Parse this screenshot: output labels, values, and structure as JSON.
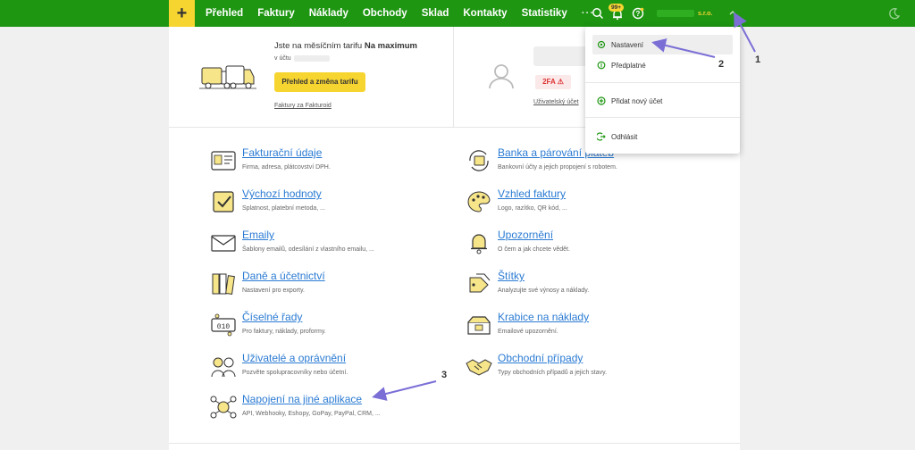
{
  "topbar": {
    "plus_label": "+",
    "nav": [
      "Přehled",
      "Faktury",
      "Náklady",
      "Obchody",
      "Sklad",
      "Kontakty",
      "Statistiky",
      "···"
    ],
    "notif_badge": "99+",
    "account_suffix": "s.r.o."
  },
  "plan": {
    "text_prefix": "Jste na měsíčním tarifu ",
    "text_bold": "Na maximum",
    "account_label": "v účtu",
    "button": "Přehled a změna tarifu",
    "link": "Faktury za Fakturoid"
  },
  "user": {
    "twofa": "2FA",
    "link": "Uživatelský účet"
  },
  "settings_left": [
    {
      "title": "Fakturační údaje",
      "desc": "Firma, adresa, plátcovství DPH."
    },
    {
      "title": "Výchozí hodnoty",
      "desc": "Splatnost, platební metoda, ..."
    },
    {
      "title": "Emaily",
      "desc": "Šablony emailů, odesílání z vlastního emailu, ..."
    },
    {
      "title": "Daně a účetnictví",
      "desc": "Nastavení pro exporty."
    },
    {
      "title": "Číselné řady",
      "desc": "Pro faktury, náklady, proformy."
    },
    {
      "title": "Uživatelé a oprávnění",
      "desc": "Pozvěte spolupracovníky nebo účetní."
    },
    {
      "title": "Napojení na jiné aplikace",
      "desc": "API, Webhooky, Eshopy, GoPay, PayPal, CRM, ..."
    }
  ],
  "settings_right": [
    {
      "title": "Banka a párování plateb",
      "desc": "Bankovní účty a jejich propojení s robotem."
    },
    {
      "title": "Vzhled faktury",
      "desc": "Logo, razítko, QR kód, ..."
    },
    {
      "title": "Upozornění",
      "desc": "O čem a jak chcete vědět."
    },
    {
      "title": "Štítky",
      "desc": "Analyzujte své výnosy a náklady."
    },
    {
      "title": "Krabice na náklady",
      "desc": "Emailové upozornění."
    },
    {
      "title": "Obchodní případy",
      "desc": "Typy obchodních případů a jejich stavy."
    }
  ],
  "dropdown": {
    "items": [
      "Nastavení",
      "Předplatné",
      "Přidat nový účet",
      "Odhlásit"
    ]
  },
  "annotations": [
    "1",
    "2",
    "3"
  ],
  "colors": {
    "brand_green": "#1e9612",
    "accent_yellow": "#f7d531",
    "link_blue": "#2b7bd3",
    "arrow": "#7b6fd6"
  }
}
